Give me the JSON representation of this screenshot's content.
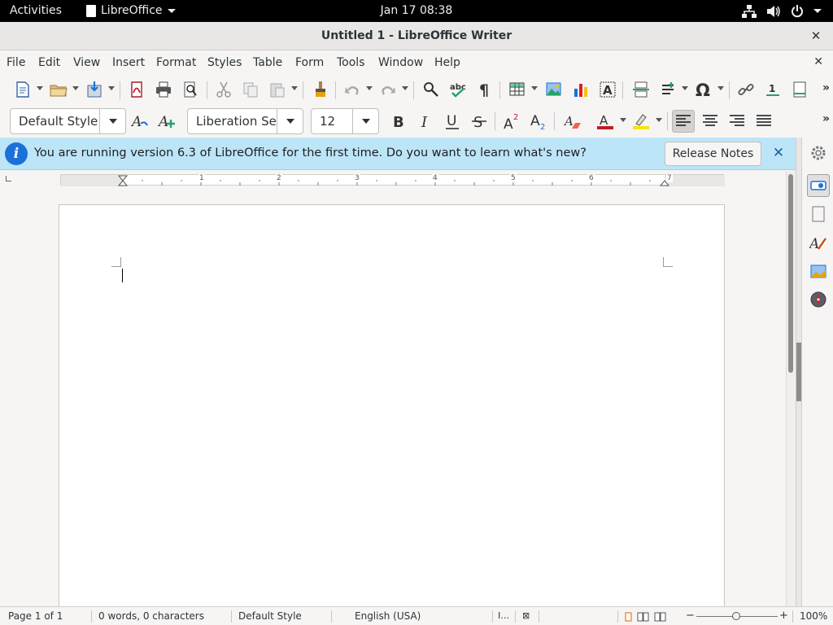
{
  "topbar": {
    "activities": "Activities",
    "app_menu": "LibreOffice",
    "clock": "Jan 17  08:38"
  },
  "window": {
    "title": "Untitled 1 - LibreOffice Writer"
  },
  "menubar": {
    "items": [
      "File",
      "Edit",
      "View",
      "Insert",
      "Format",
      "Styles",
      "Table",
      "Form",
      "Tools",
      "Window",
      "Help"
    ]
  },
  "formatting": {
    "paragraph_style": "Default Style",
    "font_name": "Liberation Se",
    "font_size": "12"
  },
  "infobar": {
    "message": "You are running version 6.3 of LibreOffice for the first time. Do you want to learn what's new?",
    "button_label": "Release Notes"
  },
  "ruler": {
    "numbers": [
      "1",
      "2",
      "3",
      "4",
      "5",
      "6",
      "7"
    ]
  },
  "statusbar": {
    "page": "Page 1 of 1",
    "word_count": "0 words, 0 characters",
    "page_style": "Default Style",
    "language": "English (USA)",
    "zoom": "100%"
  },
  "colors": {
    "infobar_bg": "#bde5f8",
    "info_icon": "#1c71d8",
    "font_color_bar": "#c01c28",
    "highlight_bar": "#f5e600"
  }
}
